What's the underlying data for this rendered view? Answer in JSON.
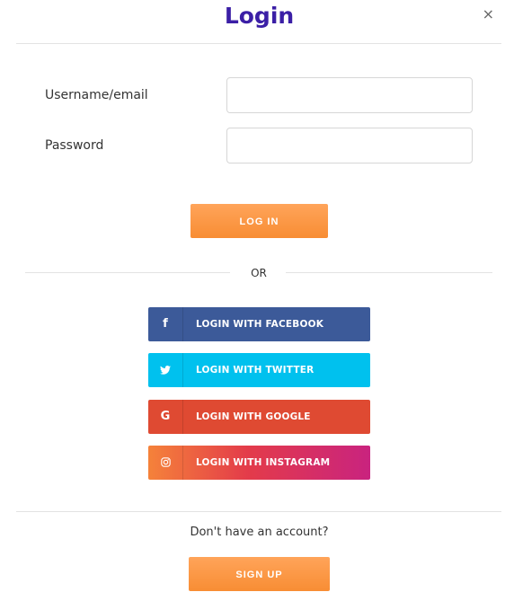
{
  "header": {
    "title": "Login",
    "close_glyph": "×"
  },
  "form": {
    "username_label": "Username/email",
    "username_value": "",
    "username_placeholder": "",
    "password_label": "Password",
    "password_value": "",
    "password_placeholder": "",
    "login_label": "LOG IN"
  },
  "divider_text": "OR",
  "social": [
    {
      "label": "LOGIN WITH FACEBOOK",
      "icon": "facebook-icon",
      "glyph": "f",
      "color": "#3c5a99"
    },
    {
      "label": "LOGIN WITH TWITTER",
      "icon": "twitter-icon",
      "glyph": "🐦",
      "color": "#00c1ee"
    },
    {
      "label": "LOGIN WITH GOOGLE",
      "icon": "google-icon",
      "glyph": "G",
      "color": "#df4a32"
    },
    {
      "label": "LOGIN WITH INSTAGRAM",
      "icon": "instagram-icon",
      "glyph": "◎",
      "color": "#e33b4a"
    }
  ],
  "footer": {
    "account_prompt": "Don't have an account?",
    "signup_label": "SIGN UP"
  },
  "colors": {
    "title": "#3b1fa6",
    "orange_button": "#f88d34"
  }
}
